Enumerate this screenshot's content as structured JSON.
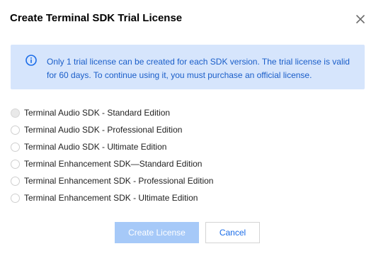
{
  "dialog": {
    "title": "Create Terminal SDK Trial License",
    "close_icon": "close-icon"
  },
  "notice": {
    "icon": "info-icon",
    "text": "Only 1 trial license can be created for each SDK version. The trial license is valid for 60 days. To continue using it, you must purchase an official license.",
    "background_color": "#d6e5fc",
    "text_color": "#1a5ec9"
  },
  "options": [
    {
      "label": "Terminal Audio SDK - Standard Edition",
      "disabled": true,
      "selected": false
    },
    {
      "label": "Terminal Audio SDK - Professional Edition",
      "disabled": false,
      "selected": false
    },
    {
      "label": "Terminal Audio SDK - Ultimate Edition",
      "disabled": false,
      "selected": false
    },
    {
      "label": "Terminal Enhancement SDK—Standard Edition",
      "disabled": false,
      "selected": false
    },
    {
      "label": "Terminal Enhancement SDK - Professional Edition",
      "disabled": false,
      "selected": false
    },
    {
      "label": "Terminal Enhancement SDK - Ultimate Edition",
      "disabled": false,
      "selected": false
    }
  ],
  "footer": {
    "create_label": "Create License",
    "create_disabled": true,
    "cancel_label": "Cancel",
    "primary_color": "#a6c9f8",
    "link_color": "#1a6ce8"
  }
}
